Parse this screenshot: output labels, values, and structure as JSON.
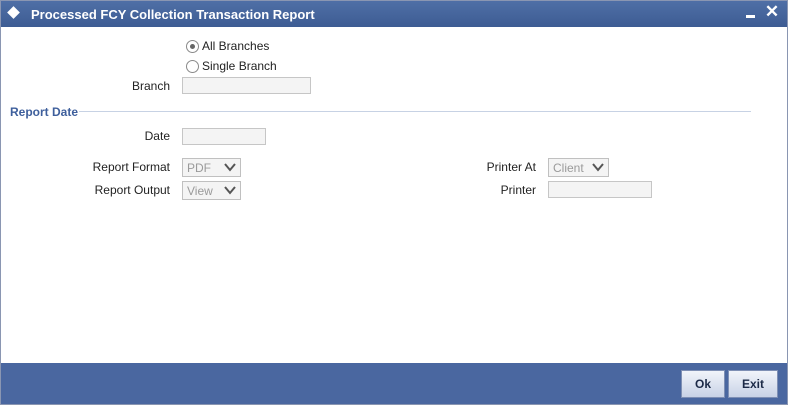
{
  "window": {
    "title": "Processed FCY Collection Transaction Report"
  },
  "branch_options": {
    "all_label": "All Branches",
    "single_label": "Single Branch",
    "selected": "All Branches"
  },
  "branch": {
    "label": "Branch",
    "value": ""
  },
  "report_date": {
    "section_label": "Report Date",
    "date_label": "Date",
    "date_value": ""
  },
  "report": {
    "format_label": "Report Format",
    "format_value": "PDF",
    "output_label": "Report Output",
    "output_value": "View",
    "printer_at_label": "Printer At",
    "printer_at_value": "Client",
    "printer_label": "Printer",
    "printer_value": ""
  },
  "footer": {
    "ok_label": "Ok",
    "exit_label": "Exit"
  }
}
